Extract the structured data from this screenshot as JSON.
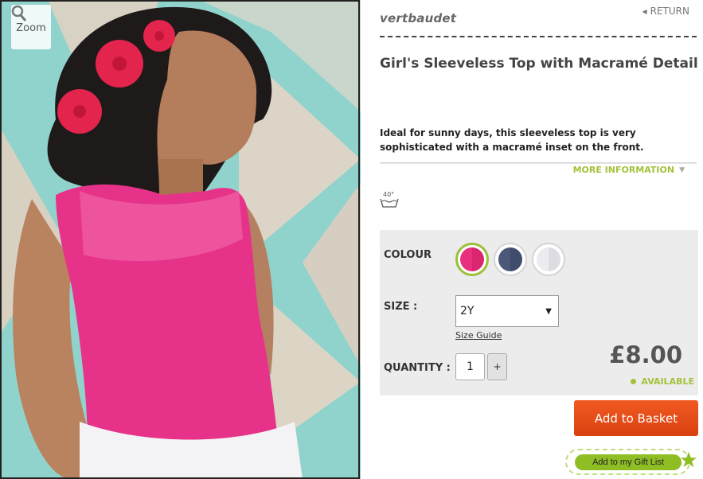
{
  "image": {
    "zoom_label": "Zoom",
    "zoom_icon": "magnifier-icon"
  },
  "header": {
    "brand": "vertbaudet",
    "return_label": "RETURN"
  },
  "product": {
    "title": "Girl's Sleeveless Top with Macramé Detail",
    "description": "Ideal for sunny days, this sleeveless top is very sophisticated with a macramé inset on the front.",
    "more_info_label": "MORE INFORMATION",
    "care_icon": "wash-40-icon",
    "wash_temp": "40°"
  },
  "options": {
    "colour_label": "COLOUR",
    "colours": [
      {
        "name": "pink",
        "hex": "#e8307f",
        "selected": true
      },
      {
        "name": "navy",
        "hex": "#4c5878",
        "selected": false
      },
      {
        "name": "white",
        "hex": "#e6e6ea",
        "selected": false
      }
    ],
    "size_label": "SIZE :",
    "size_value": "2Y",
    "size_guide_label": "Size Guide",
    "quantity_label": "QUANTITY :",
    "quantity_value": "1",
    "plus_label": "+",
    "price": "£8.00",
    "availability": "AVAILABLE"
  },
  "actions": {
    "add_basket_label": "Add to Basket",
    "gift_list_label": "Add to my Gift List"
  },
  "colors": {
    "accent_green": "#a3c23b",
    "basket_orange": "#e84c1a"
  }
}
